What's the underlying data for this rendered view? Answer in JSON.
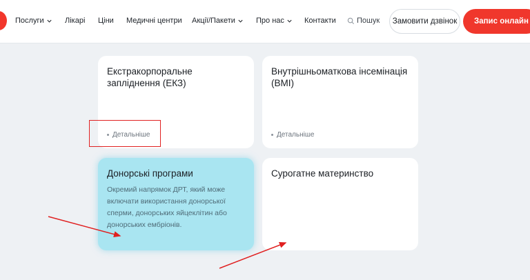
{
  "header": {
    "nav": [
      {
        "label": "Послуги",
        "has_dropdown": true
      },
      {
        "label": "Лікарі",
        "has_dropdown": false
      },
      {
        "label": "Ціни",
        "has_dropdown": false
      },
      {
        "label": "Медичні центри",
        "has_dropdown": false
      },
      {
        "label": "Акції/Пакети",
        "has_dropdown": true
      },
      {
        "label": "Про нас",
        "has_dropdown": true
      },
      {
        "label": "Контакти",
        "has_dropdown": false
      }
    ],
    "search_label": "Пошук",
    "call_button": "Замовити дзвінок",
    "book_button": "Запис онлайн"
  },
  "cards": [
    {
      "title": "Екстракорпоральне запліднення (ЕКЗ)",
      "more": "Детальніше"
    },
    {
      "title": "Внутрішньоматкова інсемінація (ВМІ)",
      "more": "Детальніше"
    },
    {
      "title": "Донорські програми",
      "description": "Окремий напрямок ДРТ, який може включати використання донорської сперми, донорських яйцеклітин або донорських ембріонів.",
      "highlighted": true
    },
    {
      "title": "Сурогатне материнство"
    }
  ],
  "colors": {
    "accent": "#f0372c",
    "page_background": "#eef1f4",
    "highlight_card": "#a9e5f1",
    "annotation": "#e02020"
  }
}
